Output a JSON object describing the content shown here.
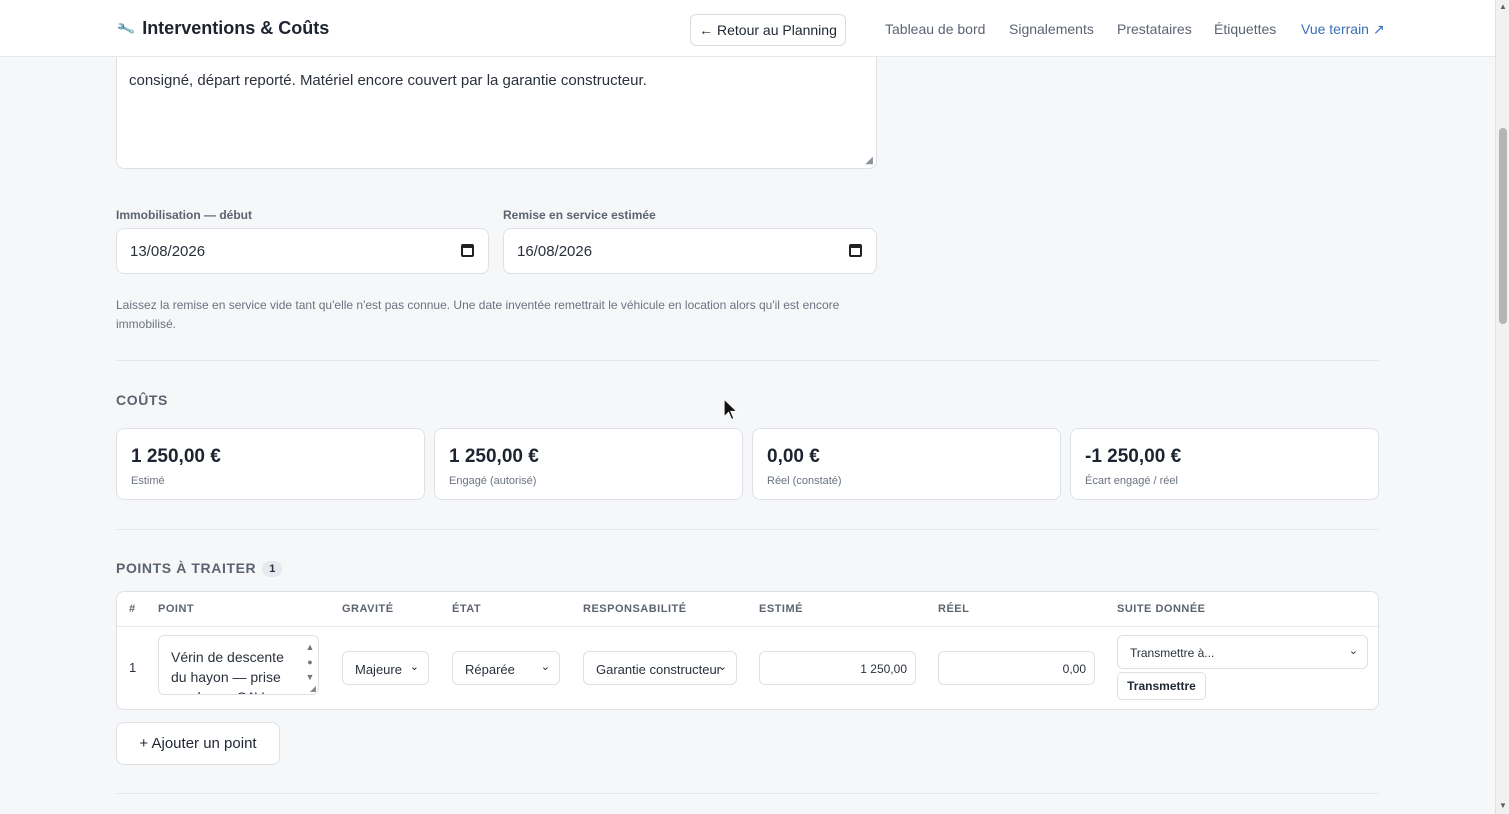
{
  "header": {
    "icon": "wrench-icon",
    "title": "Interventions & Coûts",
    "back_button": "← Retour au Planning",
    "nav": [
      "Tableau de bord",
      "Signalements",
      "Prestataires",
      "Étiquettes",
      "Vue terrain ↗"
    ]
  },
  "notes": {
    "visible_text": "consigné, départ reporté. Matériel encore couvert par la garantie constructeur."
  },
  "immobilisation": {
    "start_label": "Immobilisation — début",
    "start_value": "13/08/2026",
    "end_label": "Remise en service estimée",
    "end_value": "16/08/2026",
    "help": "Laissez la remise en service vide tant qu'elle n'est pas connue. Une date inventée remettrait le véhicule en location alors qu'il est encore immobilisé."
  },
  "costs": {
    "title": "COÛTS",
    "cards": [
      {
        "amount": "1 250,00 €",
        "caption": "Estimé"
      },
      {
        "amount": "1 250,00 €",
        "caption": "Engagé (autorisé)"
      },
      {
        "amount": "0,00 €",
        "caption": "Réel (constaté)"
      },
      {
        "amount": "-1 250,00 €",
        "caption": "Écart engagé / réel"
      }
    ]
  },
  "points": {
    "title": "POINTS À TRAITER",
    "count": "1",
    "columns": [
      "#",
      "POINT",
      "GRAVITÉ",
      "ÉTAT",
      "RESPONSABILITÉ",
      "ESTIMÉ",
      "RÉEL",
      "SUITE DONNÉE"
    ],
    "rows": [
      {
        "num": "1",
        "point": "Vérin de descente du hayon — prise en charge SAV",
        "gravite": "Majeure",
        "etat": "Réparée",
        "responsabilite": "Garantie constructeur",
        "estime": "1 250,00",
        "reel": "0,00",
        "suite_placeholder": "Transmettre à...",
        "suite_button": "Transmettre"
      }
    ],
    "add_button": "+ Ajouter un point"
  },
  "colors": {
    "accent": "#3a6fb6",
    "background": "#f6f7f9",
    "card": "#ffffff"
  }
}
